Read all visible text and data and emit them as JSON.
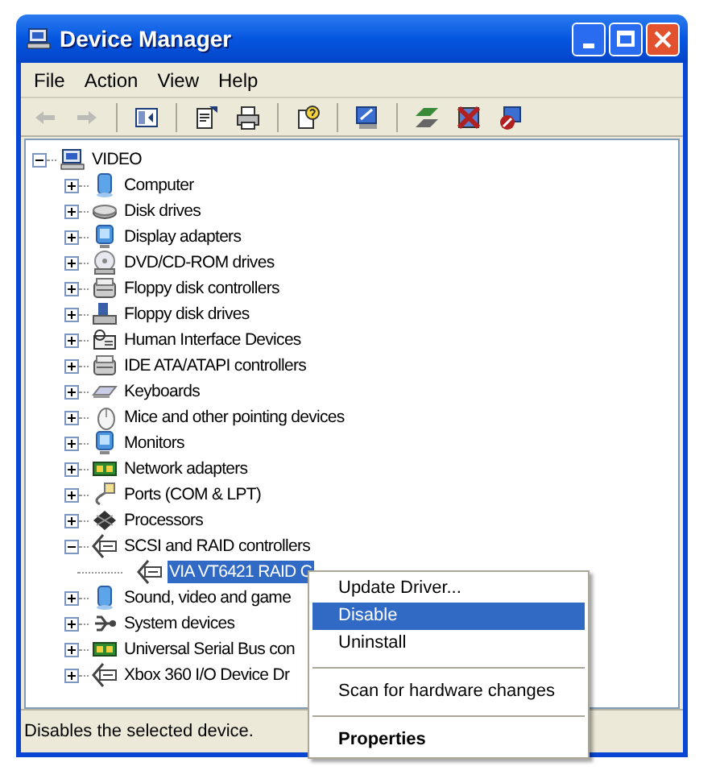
{
  "window": {
    "title": "Device Manager"
  },
  "menu_bar": [
    "File",
    "Action",
    "View",
    "Help"
  ],
  "toolbar": [
    {
      "kind": "button",
      "disabled": true
    },
    {
      "kind": "button",
      "disabled": true
    },
    {
      "kind": "separator"
    },
    {
      "kind": "button",
      "disabled": false
    },
    {
      "kind": "separator"
    },
    {
      "kind": "button",
      "disabled": false
    },
    {
      "kind": "button",
      "disabled": false
    },
    {
      "kind": "separator"
    },
    {
      "kind": "button",
      "disabled": false
    },
    {
      "kind": "separator"
    },
    {
      "kind": "button",
      "disabled": false
    },
    {
      "kind": "separator"
    },
    {
      "kind": "button",
      "disabled": false
    },
    {
      "kind": "button",
      "disabled": false
    },
    {
      "kind": "button",
      "disabled": false
    }
  ],
  "tree": [
    {
      "label": "VIDEO",
      "expanded": true,
      "selected": false,
      "children": [
        {
          "label": "Computer",
          "expanded": false,
          "selected": false
        },
        {
          "label": "Disk drives",
          "expanded": false,
          "selected": false
        },
        {
          "label": "Display adapters",
          "expanded": false,
          "selected": false
        },
        {
          "label": "DVD/CD-ROM drives",
          "expanded": false,
          "selected": false
        },
        {
          "label": "Floppy disk controllers",
          "expanded": false,
          "selected": false
        },
        {
          "label": "Floppy disk drives",
          "expanded": false,
          "selected": false
        },
        {
          "label": "Human Interface Devices",
          "expanded": false,
          "selected": false
        },
        {
          "label": "IDE ATA/ATAPI controllers",
          "expanded": false,
          "selected": false
        },
        {
          "label": "Keyboards",
          "expanded": false,
          "selected": false
        },
        {
          "label": "Mice and other pointing devices",
          "expanded": false,
          "selected": false
        },
        {
          "label": "Monitors",
          "expanded": false,
          "selected": false
        },
        {
          "label": "Network adapters",
          "expanded": false,
          "selected": false
        },
        {
          "label": "Ports (COM & LPT)",
          "expanded": false,
          "selected": false
        },
        {
          "label": "Processors",
          "expanded": false,
          "selected": false
        },
        {
          "label": "SCSI and RAID controllers",
          "expanded": true,
          "selected": false,
          "children": [
            {
              "label": "VIA VT6421 RAID C",
              "selected": true
            }
          ]
        },
        {
          "label": "Sound, video and game",
          "expanded": false,
          "selected": false
        },
        {
          "label": "System devices",
          "expanded": false,
          "selected": false
        },
        {
          "label": "Universal Serial Bus con",
          "expanded": false,
          "selected": false
        },
        {
          "label": "Xbox 360 I/O Device Dr",
          "expanded": false,
          "selected": false
        }
      ]
    }
  ],
  "context_menu": [
    {
      "kind": "item",
      "label": "Update Driver...",
      "selected": false,
      "default": false
    },
    {
      "kind": "item",
      "label": "Disable",
      "selected": true,
      "default": false
    },
    {
      "kind": "item",
      "label": "Uninstall",
      "selected": false,
      "default": false
    },
    {
      "kind": "separator"
    },
    {
      "kind": "item",
      "label": "Scan for hardware changes",
      "selected": false,
      "default": false
    },
    {
      "kind": "separator"
    },
    {
      "kind": "item",
      "label": "Properties",
      "selected": false,
      "default": true
    }
  ],
  "status_bar": "Disables the selected device."
}
